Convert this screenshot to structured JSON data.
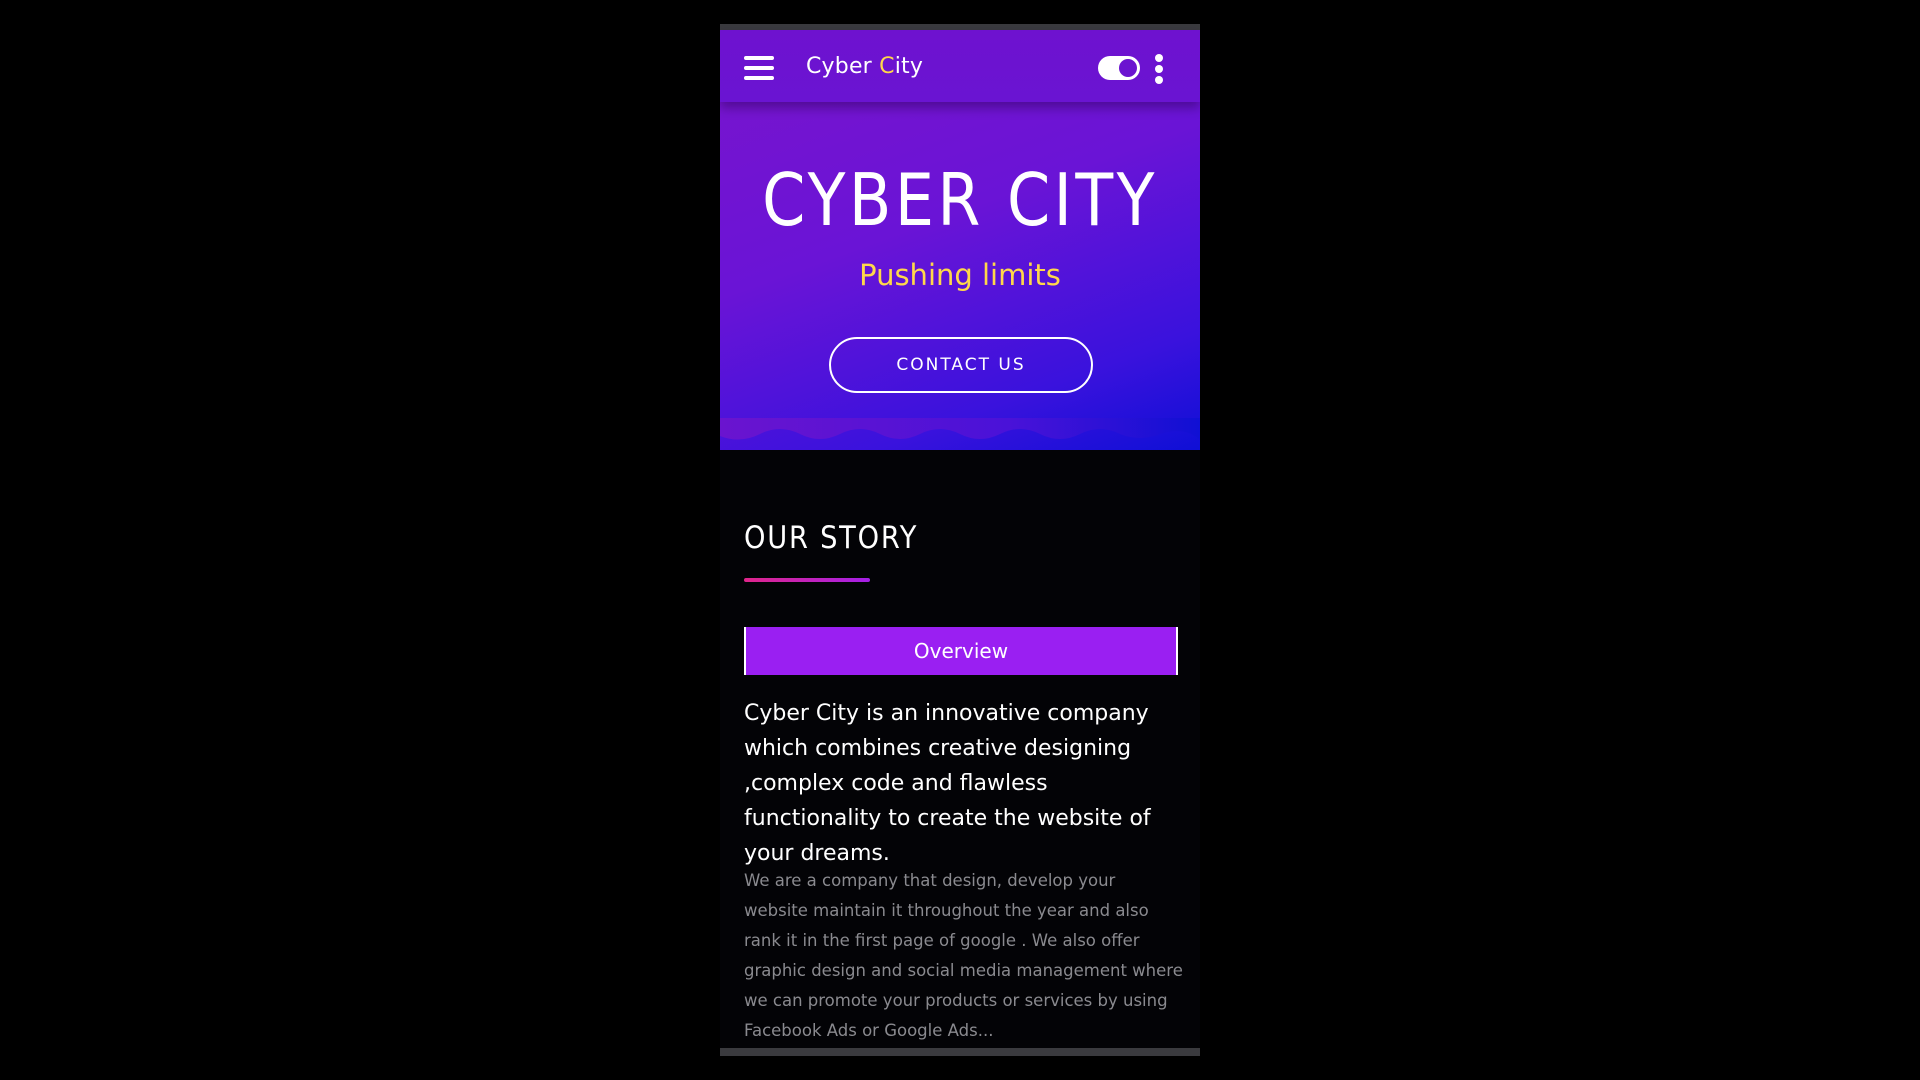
{
  "colors": {
    "page_background": "#000000",
    "hero_gradient_start": "#7a15cc",
    "hero_gradient_end": "#0f0fd6",
    "accent_yellow": "#ffd84a",
    "tab_purple": "#9a1ff2",
    "underline_pink": "#e0258a"
  },
  "app_bar": {
    "menu_icon": "hamburger-menu-icon",
    "title_prefix": "Cyber ",
    "title_highlight": "C",
    "title_suffix": "ity",
    "toggle_icon": "theme-toggle-icon",
    "toggle_state": "on",
    "more_icon": "more-vertical-icon"
  },
  "hero": {
    "title": "CYBER CITY",
    "subtitle": "Pushing limits",
    "cta_label": "CONTACT US"
  },
  "story": {
    "heading": "OUR STORY",
    "tab_label": "Overview",
    "lead": "Cyber City is an innovative company which combines creative designing ,complex code and flawless functionality to create the website of your dreams.",
    "body": "We are a company that design, develop your website maintain it throughout the year and also rank it in the first page of google . We also offer graphic design and social media management where we can promote your products or services by using Facebook Ads or Google Ads..."
  }
}
